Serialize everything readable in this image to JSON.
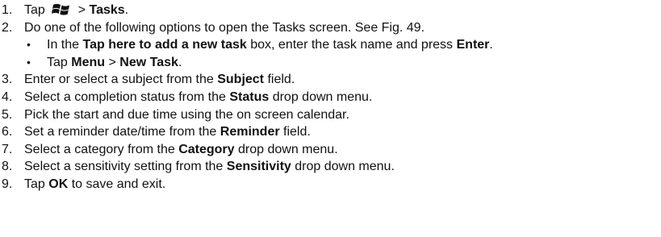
{
  "steps": [
    {
      "num": "1.",
      "t0": "Tap ",
      "icon": "windows-start-icon",
      "t1": " > ",
      "b1": "Tasks",
      "t2": "."
    },
    {
      "num": "2.",
      "t0": "Do one of the following options to open the Tasks screen.  See Fig. 49."
    },
    {
      "num": "3.",
      "t0": "Enter or select a subject from the ",
      "b1": "Subject",
      "t2": " field."
    },
    {
      "num": "4.",
      "t0": "Select a completion status from the ",
      "b1": "Status",
      "t2": " drop down menu."
    },
    {
      "num": "5.",
      "t0": "Pick the start and due time using the on screen calendar."
    },
    {
      "num": "6.",
      "t0": "Set a reminder date/time from the ",
      "b1": "Reminder",
      "t2": " field."
    },
    {
      "num": "7.",
      "t0": "Select a category from the ",
      "b1": "Category",
      "t2": " drop down menu."
    },
    {
      "num": "8.",
      "t0": "Select a sensitivity setting from the ",
      "b1": "Sensitivity",
      "t2": " drop down menu."
    },
    {
      "num": "9.",
      "t0": "Tap ",
      "b1": "OK",
      "t2": " to save and exit."
    }
  ],
  "substeps": [
    {
      "bullet": "•",
      "t0": "In the ",
      "b1": "Tap here to add a new task",
      "t1": " box, enter the task name and press ",
      "b2": "Enter",
      "t2": "."
    },
    {
      "bullet": "•",
      "t0": "Tap ",
      "b1": "Menu",
      "t1": " > ",
      "b2": "New Task",
      "t2": "."
    }
  ]
}
